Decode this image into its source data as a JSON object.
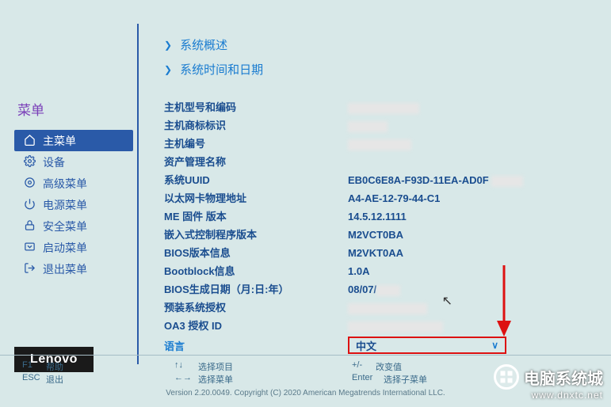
{
  "sidebar": {
    "title": "菜单",
    "items": [
      {
        "label": "主菜单"
      },
      {
        "label": "设备"
      },
      {
        "label": "高级菜单"
      },
      {
        "label": "电源菜单"
      },
      {
        "label": "安全菜单"
      },
      {
        "label": "启动菜单"
      },
      {
        "label": "退出菜单"
      }
    ]
  },
  "brand": "Lenovo",
  "links": {
    "overview": "系统概述",
    "datetime": "系统时间和日期"
  },
  "info": [
    {
      "label": "主机型号和编码",
      "value": ""
    },
    {
      "label": "主机商标标识",
      "value": ""
    },
    {
      "label": "主机编号",
      "value": ""
    },
    {
      "label": "资产管理名称",
      "value": ""
    },
    {
      "label": "系统UUID",
      "value": "EB0C6E8A-F93D-11EA-AD0F"
    },
    {
      "label": "以太网卡物理地址",
      "value": "A4-AE-12-79-44-C1"
    },
    {
      "label": "ME 固件 版本",
      "value": "14.5.12.1111"
    },
    {
      "label": "嵌入式控制程序版本",
      "value": "M2VCT0BA"
    },
    {
      "label": "BIOS版本信息",
      "value": "M2VKT0AA"
    },
    {
      "label": "Bootblock信息",
      "value": "1.0A"
    },
    {
      "label": "BIOS生成日期（月:日:年）",
      "value": "08/07/"
    },
    {
      "label": "预装系统授权",
      "value": ""
    },
    {
      "label": "OA3 授权 ID",
      "value": ""
    }
  ],
  "language": {
    "label": "语言",
    "value": "中文"
  },
  "footer": {
    "f1": {
      "key": "F1",
      "label": "帮助"
    },
    "esc": {
      "key": "ESC",
      "label": "退出"
    },
    "updown": {
      "key": "↑↓",
      "label": "选择项目"
    },
    "leftright": {
      "key": "←→",
      "label": "选择菜单"
    },
    "plusminus": {
      "key": "+/-",
      "label": "改变值"
    },
    "enter": {
      "key": "Enter",
      "label": "选择子菜单"
    },
    "copyright": "Version 2.20.0049. Copyright (C) 2020 American Megatrends International LLC."
  },
  "watermark": {
    "title": "电脑系统城",
    "url": "www.dnxtc.net"
  }
}
